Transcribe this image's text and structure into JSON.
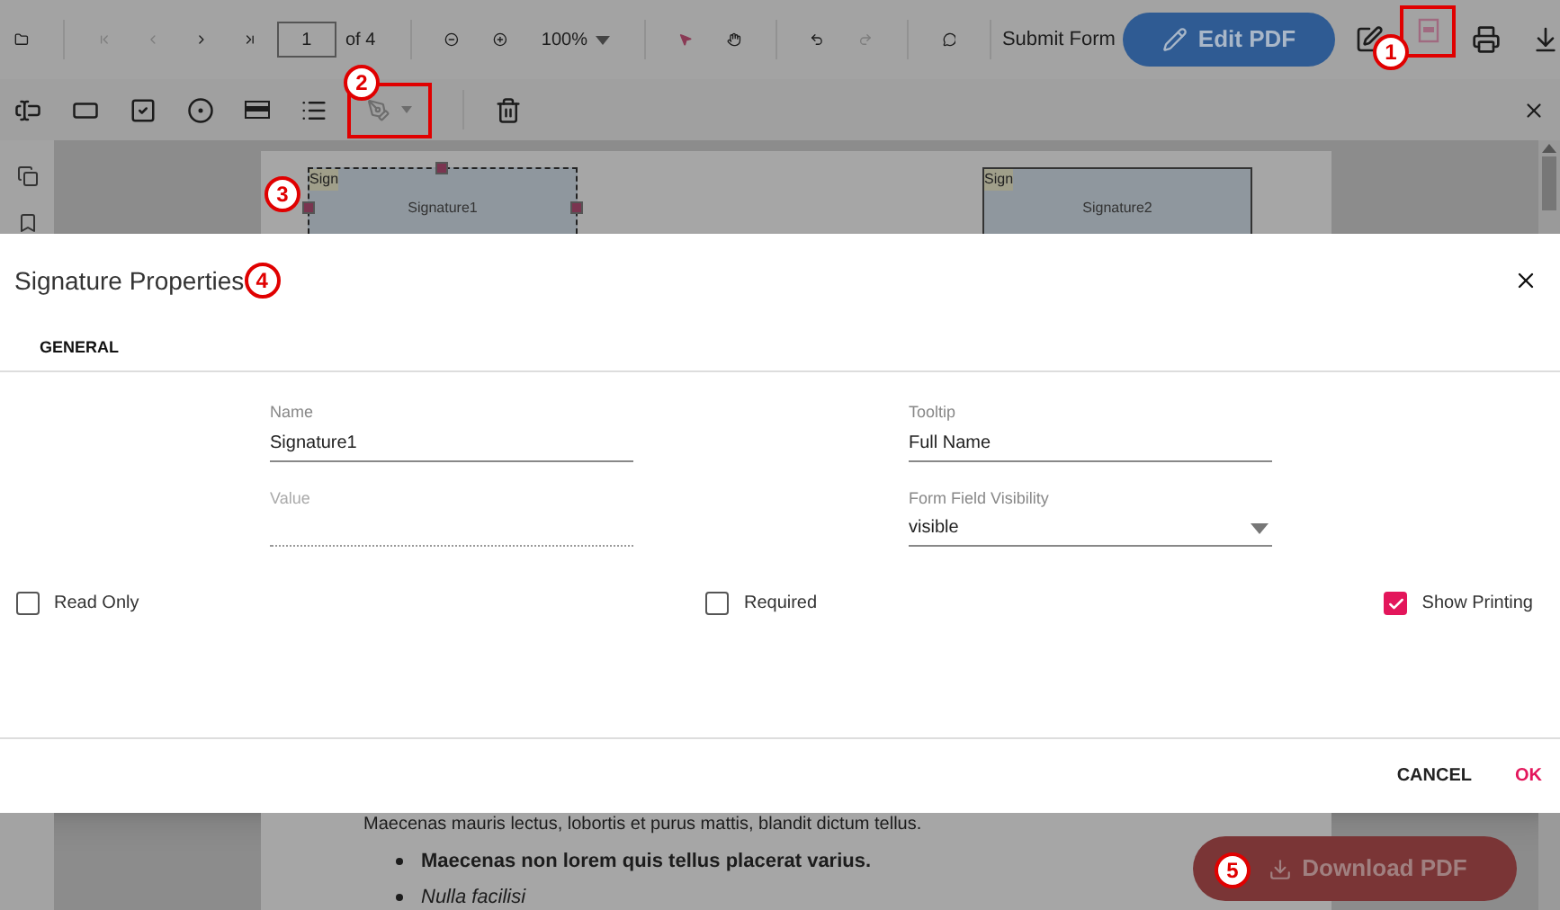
{
  "toolbar": {
    "page_field": "1",
    "page_count": "of 4",
    "zoom": "100%",
    "submit_label": "Submit Form",
    "edit_button": "Edit PDF"
  },
  "document": {
    "signature_fields": [
      {
        "tag": "Sign",
        "name": "Signature1",
        "selected": true
      },
      {
        "tag": "Sign",
        "name": "Signature2",
        "selected": false
      }
    ],
    "text_line": "Maecenas mauris lectus, lobortis et purus mattis, blandit dictum tellus.",
    "bullets": [
      {
        "text": "Maecenas non lorem quis tellus placerat varius.",
        "kind": "bold"
      },
      {
        "text": "Nulla facilisi",
        "kind": "italic"
      }
    ]
  },
  "dialog": {
    "title": "Signature Properties",
    "tabs": [
      {
        "label": "GENERAL",
        "selected": true
      }
    ],
    "fields": [
      {
        "kind": "text",
        "label": "Name",
        "value": "Signature1",
        "disabled": false
      },
      {
        "kind": "text",
        "label": "Tooltip",
        "value": "Full Name",
        "disabled": false
      },
      {
        "kind": "text",
        "label": "Value",
        "disabled": true
      },
      {
        "kind": "dropdown",
        "label": "Form Field Visibility",
        "value": "visible",
        "disabled": false
      }
    ],
    "checkboxes": [
      {
        "label": "Read Only",
        "checked": false
      },
      {
        "label": "Required",
        "checked": false
      },
      {
        "label": "Show Printing",
        "checked": true
      }
    ],
    "buttons": [
      {
        "label": "CANCEL",
        "kind": "secondary"
      },
      {
        "label": "OK",
        "kind": "primary"
      }
    ]
  },
  "download_button": {
    "label": "Download PDF"
  },
  "annotations": [
    {
      "number": "1"
    },
    {
      "number": "2"
    },
    {
      "number": "3"
    },
    {
      "number": "4"
    },
    {
      "number": "5"
    }
  ]
}
